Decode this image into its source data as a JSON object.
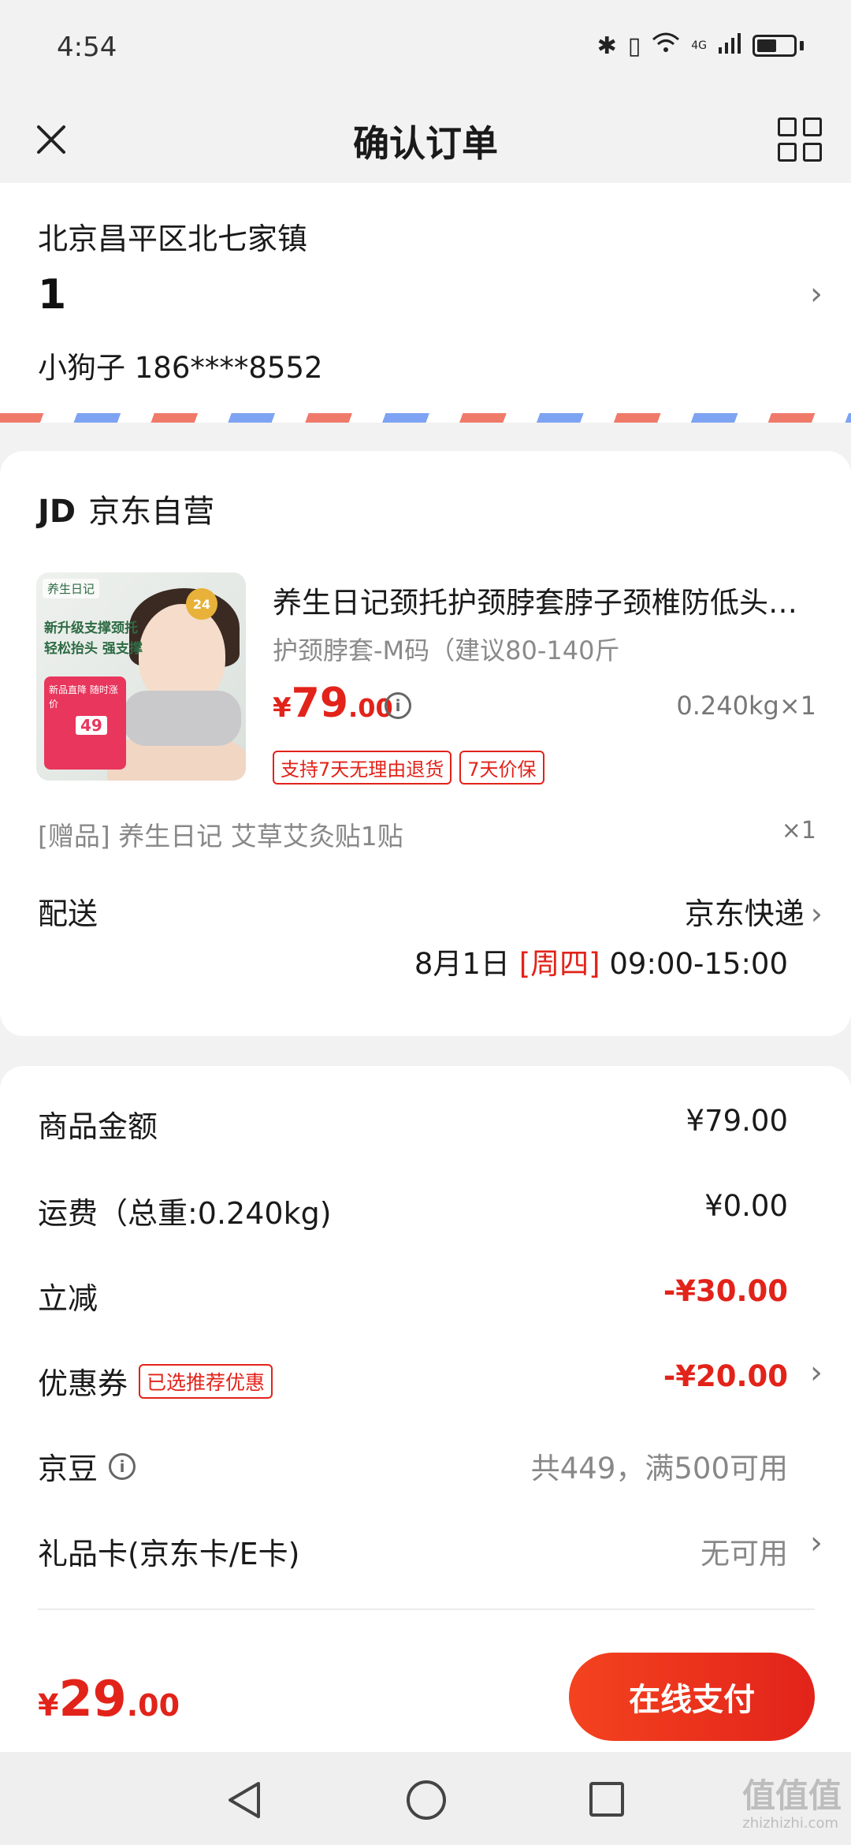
{
  "status_bar": {
    "time": "4:54",
    "network": "4G"
  },
  "nav": {
    "title": "确认订单"
  },
  "address": {
    "region": "北京昌平区北七家镇",
    "detail": "1",
    "contact": "小狗子 186****8552"
  },
  "shop": {
    "logo": "JD",
    "name": "京东自营"
  },
  "product": {
    "image_tag": "养生日记",
    "image_line1": "新升级支撑颈托",
    "image_line2": "轻松抬头 强支撑",
    "image_promo": "新品直降 随时涨价",
    "image_promo_price": "49",
    "image_badge": "24",
    "title": "养生日记颈托护颈脖套脖子颈椎防低头神器",
    "spec": "护颈脖套-M码（建议80-140斤",
    "price_symbol": "¥",
    "price_int": "79",
    "price_dec": ".00",
    "weight_qty": "0.240kg×1",
    "tags": [
      "支持7天无理由退货",
      "7天价保"
    ]
  },
  "gift": {
    "label": "[赠品] 养生日记 艾草艾灸贴1贴",
    "qty": "×1"
  },
  "shipping": {
    "label": "配送",
    "carrier": "京东快递",
    "date": "8月1日",
    "weekday": "[周四]",
    "window": "09:00-15:00"
  },
  "summary": {
    "goods_label": "商品金额",
    "goods_value": "¥79.00",
    "freight_label": "运费（总重:0.240kg)",
    "freight_value": "¥0.00",
    "discount_label": "立减",
    "discount_value": "-¥30.00",
    "coupon_label": "优惠券",
    "coupon_tag": "已选推荐优惠",
    "coupon_value": "-¥20.00",
    "jingdou_label": "京豆",
    "jingdou_value": "共449，满500可用",
    "giftcard_label": "礼品卡(京东卡/E卡)",
    "giftcard_value": "无可用"
  },
  "bottom": {
    "total_symbol": "¥",
    "total_int": "29",
    "total_dec": ".00",
    "pay_label": "在线支付"
  },
  "watermark": {
    "main": "值值值",
    "sub": "zhizhizhi.com"
  },
  "colors": {
    "accent_red": "#e2231a",
    "background": "#f2f2f2"
  }
}
